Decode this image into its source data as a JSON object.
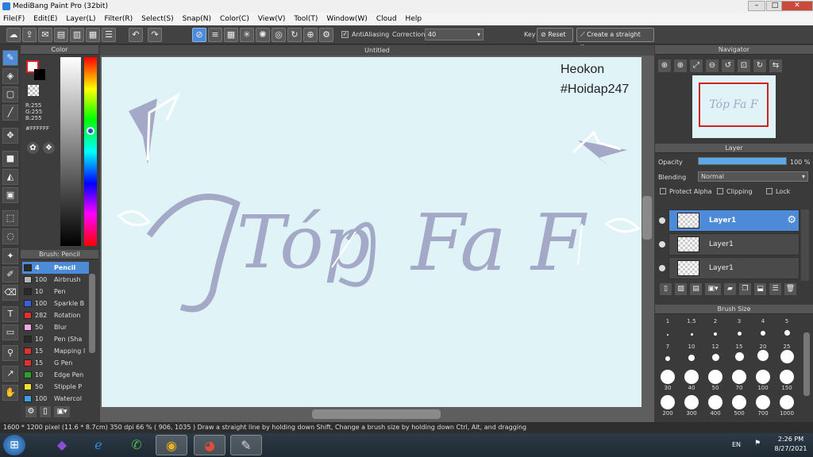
{
  "window": {
    "title": "MediBang Paint Pro (32bit)",
    "min": "–",
    "max": "□",
    "close": "✕"
  },
  "menu": [
    "File(F)",
    "Edit(E)",
    "Layer(L)",
    "Filter(R)",
    "Select(S)",
    "Snap(N)",
    "Color(C)",
    "View(V)",
    "Tool(T)",
    "Window(W)",
    "Cloud",
    "Help"
  ],
  "toolbar": {
    "antialiasing": "AntiAliasing",
    "correction_label": "Correction",
    "correction_value": "40",
    "key_label": "Key",
    "reset": "Reset",
    "straight_line": "Create a straight line"
  },
  "color": {
    "title": "Color",
    "r": "R:255",
    "g": "G:255",
    "b": "B:255",
    "hex": "#FFFFFF"
  },
  "brush_panel": {
    "title": "Brush: Pencil",
    "items": [
      {
        "size": "4",
        "name": "Pencil",
        "color": "#2a2a2a"
      },
      {
        "size": "100",
        "name": "Airbrush",
        "color": "#b5b5b5"
      },
      {
        "size": "10",
        "name": "Pen",
        "color": "#2a2a2a"
      },
      {
        "size": "100",
        "name": "Sparkle B",
        "color": "#3a5fe0"
      },
      {
        "size": "282",
        "name": "Rotation",
        "color": "#e03030"
      },
      {
        "size": "50",
        "name": "Blur",
        "color": "#f4a6e6"
      },
      {
        "size": "10",
        "name": "Pen (Sha",
        "color": "#2a2a2a"
      },
      {
        "size": "15",
        "name": "Mapping I",
        "color": "#e03030"
      },
      {
        "size": "15",
        "name": "G Pen",
        "color": "#e03030"
      },
      {
        "size": "10",
        "name": "Edge Pen",
        "color": "#2ca02c"
      },
      {
        "size": "50",
        "name": "Stipple P",
        "color": "#f0e030"
      },
      {
        "size": "100",
        "name": "Watercol",
        "color": "#3aa0e0"
      }
    ]
  },
  "canvas": {
    "tab": "Untitled",
    "credit1": "Heokon",
    "credit2": "#Hoidap247",
    "art_word1": "Tóp",
    "art_word2": "Fa F"
  },
  "navigator": {
    "title": "Navigator",
    "thumb_text": "Tóp Fa F"
  },
  "layer_panel": {
    "title": "Layer",
    "opacity_label": "Opacity",
    "opacity_value": "100 %",
    "opacity_fraction": 1.0,
    "blending_label": "Blending",
    "blending_value": "Normal",
    "protect_alpha": "Protect Alpha",
    "clipping": "Clipping",
    "lock": "Lock",
    "layers": [
      {
        "name": "Layer1",
        "selected": true
      },
      {
        "name": "Layer1",
        "selected": false
      },
      {
        "name": "Layer1",
        "selected": false
      }
    ]
  },
  "brush_size": {
    "title": "Brush Size",
    "row1": [
      "1",
      "1.5",
      "2",
      "3",
      "4",
      "5"
    ],
    "row2": [
      "7",
      "10",
      "12",
      "15",
      "20",
      "25"
    ],
    "row3": [
      "30",
      "40",
      "50",
      "70",
      "100",
      "150"
    ],
    "row4": [
      "200",
      "300",
      "400",
      "500",
      "700",
      "1000"
    ]
  },
  "status": "1600 * 1200 pixel   (11.6 * 8.7cm)   350 dpi   66 %   ( 906, 1035 )   Draw a straight line by holding down Shift, Change a brush size by holding down Ctrl, Alt, and dragging",
  "taskbar": {
    "lang": "EN",
    "time": "2:26 PM",
    "date": "8/27/2021"
  },
  "colors": {
    "accent": "#4d8ad8",
    "canvas": "#e0f3f7",
    "ink": "#a3a9c6"
  }
}
